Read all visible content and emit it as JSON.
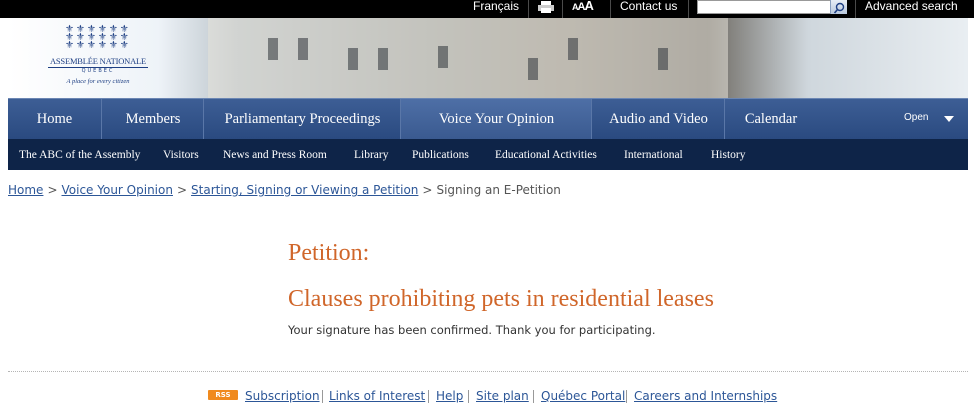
{
  "topbar": {
    "language": "Français",
    "print_icon": "printer-icon",
    "font_size": "AAA",
    "contact": "Contact us",
    "search": {
      "placeholder": "",
      "icon": "search-icon"
    },
    "advanced_search": "Advanced search"
  },
  "logo": {
    "name": "ASSEMBLÉE NATIONALE",
    "region": "QUÉBEC",
    "tagline": "A place for every citizen"
  },
  "nav_primary": {
    "items": [
      {
        "label": "Home"
      },
      {
        "label": "Members"
      },
      {
        "label": "Parliamentary Proceedings"
      },
      {
        "label": "Voice Your Opinion"
      },
      {
        "label": "Audio and Video"
      },
      {
        "label": "Calendar"
      }
    ],
    "open_label": "Open"
  },
  "nav_secondary": {
    "items": [
      {
        "label": "The ABC of the Assembly"
      },
      {
        "label": "Visitors"
      },
      {
        "label": "News and Press Room"
      },
      {
        "label": "Library"
      },
      {
        "label": "Publications"
      },
      {
        "label": "Educational Activities"
      },
      {
        "label": "International"
      },
      {
        "label": "History"
      }
    ]
  },
  "breadcrumb": {
    "items": [
      {
        "label": "Home"
      },
      {
        "label": "Voice Your Opinion"
      },
      {
        "label": "Starting, Signing or Viewing a Petition"
      }
    ],
    "current": "Signing an E-Petition",
    "separator": ">"
  },
  "content": {
    "label": "Petition:",
    "title": "Clauses prohibiting pets in residential leases",
    "message": "Your signature has been confirmed. Thank you for participating."
  },
  "footer": {
    "rss": "RSS",
    "links": [
      {
        "label": "Subscription"
      },
      {
        "label": "Links of Interest"
      },
      {
        "label": "Help"
      },
      {
        "label": "Site plan"
      },
      {
        "label": "Québec Portal"
      },
      {
        "label": "Careers and Internships"
      }
    ]
  },
  "colors": {
    "nav_primary": "#2f4f86",
    "nav_secondary": "#0e2448",
    "accent_orange": "#d0662a",
    "link": "#2c5697"
  }
}
